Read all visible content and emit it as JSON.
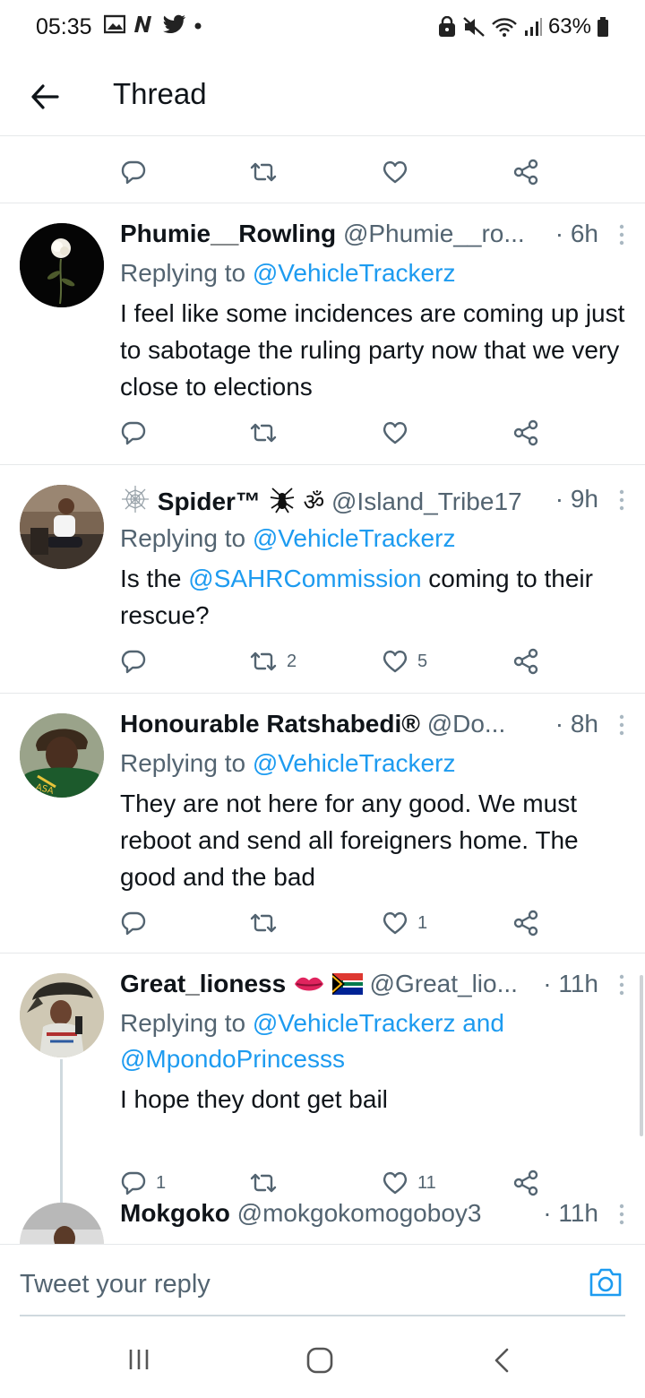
{
  "status_bar": {
    "time": "05:35",
    "battery": "63%"
  },
  "app_bar": {
    "title": "Thread"
  },
  "tweets": [
    {
      "name": "Phumie__Rowling",
      "handle": "@Phumie__ro...",
      "time": "· 6h",
      "replying_prefix": "Replying to ",
      "replying_to": "@VehicleTrackerz",
      "text": "I feel like some incidences are coming up just to sabotage the ruling party now that we very close to elections",
      "reply_count": "",
      "retweet_count": "",
      "like_count": ""
    },
    {
      "name": "Spider™",
      "name_emoji": "🕷ॐ",
      "handle": "@Island_Tribe17",
      "time": "· 9h",
      "replying_prefix": "Replying to ",
      "replying_to": "@VehicleTrackerz",
      "text_before": "Is the ",
      "text_mention": "@SAHRCommission",
      "text_after": " coming to their rescue?",
      "retweet_count": "2",
      "like_count": "5"
    },
    {
      "name": "Honourable Ratshabedi®",
      "handle": "@Do...",
      "time": "· 8h",
      "replying_prefix": "Replying to ",
      "replying_to": "@VehicleTrackerz",
      "text": "They are not here for any good. We must reboot and send all foreigners home. The good and the bad",
      "like_count": "1"
    },
    {
      "name": "Great_lioness",
      "handle": "@Great_lio...",
      "time": "· 11h",
      "replying_prefix": "Replying to ",
      "replying_to": "@VehicleTrackerz and @MpondoPrincesss",
      "text": "I hope they dont get bail",
      "reply_count": "1",
      "like_count": "11"
    },
    {
      "name": "Mokgoko",
      "handle": "@mokgokomogoboy3",
      "time": "· 11h"
    }
  ],
  "composer": {
    "placeholder": "Tweet your reply"
  },
  "icons": {
    "reply": "reply-icon",
    "retweet": "retweet-icon",
    "like": "heart-icon",
    "share": "share-icon",
    "more": "more-vertical-icon",
    "back": "arrow-left-icon",
    "camera": "camera-icon"
  },
  "colors": {
    "link": "#1d9bf0",
    "secondary_text": "#536471",
    "primary_text": "#0f1419"
  }
}
